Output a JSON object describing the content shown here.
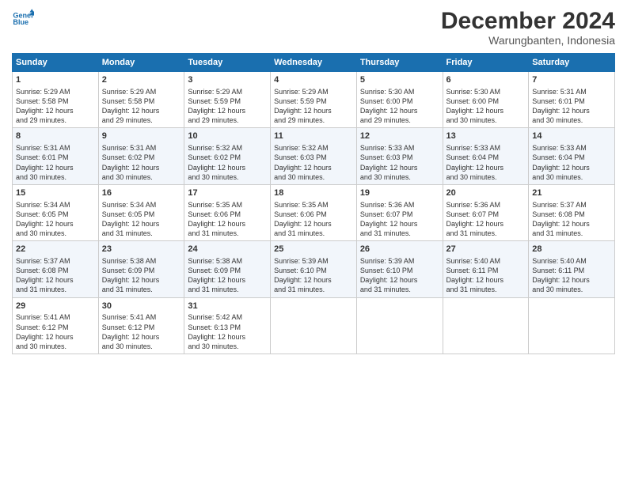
{
  "logo": {
    "line1": "General",
    "line2": "Blue"
  },
  "title": "December 2024",
  "subtitle": "Warungbanten, Indonesia",
  "days_header": [
    "Sunday",
    "Monday",
    "Tuesday",
    "Wednesday",
    "Thursday",
    "Friday",
    "Saturday"
  ],
  "weeks": [
    [
      {
        "day": "1",
        "lines": [
          "Sunrise: 5:29 AM",
          "Sunset: 5:58 PM",
          "Daylight: 12 hours",
          "and 29 minutes."
        ]
      },
      {
        "day": "2",
        "lines": [
          "Sunrise: 5:29 AM",
          "Sunset: 5:58 PM",
          "Daylight: 12 hours",
          "and 29 minutes."
        ]
      },
      {
        "day": "3",
        "lines": [
          "Sunrise: 5:29 AM",
          "Sunset: 5:59 PM",
          "Daylight: 12 hours",
          "and 29 minutes."
        ]
      },
      {
        "day": "4",
        "lines": [
          "Sunrise: 5:29 AM",
          "Sunset: 5:59 PM",
          "Daylight: 12 hours",
          "and 29 minutes."
        ]
      },
      {
        "day": "5",
        "lines": [
          "Sunrise: 5:30 AM",
          "Sunset: 6:00 PM",
          "Daylight: 12 hours",
          "and 29 minutes."
        ]
      },
      {
        "day": "6",
        "lines": [
          "Sunrise: 5:30 AM",
          "Sunset: 6:00 PM",
          "Daylight: 12 hours",
          "and 30 minutes."
        ]
      },
      {
        "day": "7",
        "lines": [
          "Sunrise: 5:31 AM",
          "Sunset: 6:01 PM",
          "Daylight: 12 hours",
          "and 30 minutes."
        ]
      }
    ],
    [
      {
        "day": "8",
        "lines": [
          "Sunrise: 5:31 AM",
          "Sunset: 6:01 PM",
          "Daylight: 12 hours",
          "and 30 minutes."
        ]
      },
      {
        "day": "9",
        "lines": [
          "Sunrise: 5:31 AM",
          "Sunset: 6:02 PM",
          "Daylight: 12 hours",
          "and 30 minutes."
        ]
      },
      {
        "day": "10",
        "lines": [
          "Sunrise: 5:32 AM",
          "Sunset: 6:02 PM",
          "Daylight: 12 hours",
          "and 30 minutes."
        ]
      },
      {
        "day": "11",
        "lines": [
          "Sunrise: 5:32 AM",
          "Sunset: 6:03 PM",
          "Daylight: 12 hours",
          "and 30 minutes."
        ]
      },
      {
        "day": "12",
        "lines": [
          "Sunrise: 5:33 AM",
          "Sunset: 6:03 PM",
          "Daylight: 12 hours",
          "and 30 minutes."
        ]
      },
      {
        "day": "13",
        "lines": [
          "Sunrise: 5:33 AM",
          "Sunset: 6:04 PM",
          "Daylight: 12 hours",
          "and 30 minutes."
        ]
      },
      {
        "day": "14",
        "lines": [
          "Sunrise: 5:33 AM",
          "Sunset: 6:04 PM",
          "Daylight: 12 hours",
          "and 30 minutes."
        ]
      }
    ],
    [
      {
        "day": "15",
        "lines": [
          "Sunrise: 5:34 AM",
          "Sunset: 6:05 PM",
          "Daylight: 12 hours",
          "and 30 minutes."
        ]
      },
      {
        "day": "16",
        "lines": [
          "Sunrise: 5:34 AM",
          "Sunset: 6:05 PM",
          "Daylight: 12 hours",
          "and 31 minutes."
        ]
      },
      {
        "day": "17",
        "lines": [
          "Sunrise: 5:35 AM",
          "Sunset: 6:06 PM",
          "Daylight: 12 hours",
          "and 31 minutes."
        ]
      },
      {
        "day": "18",
        "lines": [
          "Sunrise: 5:35 AM",
          "Sunset: 6:06 PM",
          "Daylight: 12 hours",
          "and 31 minutes."
        ]
      },
      {
        "day": "19",
        "lines": [
          "Sunrise: 5:36 AM",
          "Sunset: 6:07 PM",
          "Daylight: 12 hours",
          "and 31 minutes."
        ]
      },
      {
        "day": "20",
        "lines": [
          "Sunrise: 5:36 AM",
          "Sunset: 6:07 PM",
          "Daylight: 12 hours",
          "and 31 minutes."
        ]
      },
      {
        "day": "21",
        "lines": [
          "Sunrise: 5:37 AM",
          "Sunset: 6:08 PM",
          "Daylight: 12 hours",
          "and 31 minutes."
        ]
      }
    ],
    [
      {
        "day": "22",
        "lines": [
          "Sunrise: 5:37 AM",
          "Sunset: 6:08 PM",
          "Daylight: 12 hours",
          "and 31 minutes."
        ]
      },
      {
        "day": "23",
        "lines": [
          "Sunrise: 5:38 AM",
          "Sunset: 6:09 PM",
          "Daylight: 12 hours",
          "and 31 minutes."
        ]
      },
      {
        "day": "24",
        "lines": [
          "Sunrise: 5:38 AM",
          "Sunset: 6:09 PM",
          "Daylight: 12 hours",
          "and 31 minutes."
        ]
      },
      {
        "day": "25",
        "lines": [
          "Sunrise: 5:39 AM",
          "Sunset: 6:10 PM",
          "Daylight: 12 hours",
          "and 31 minutes."
        ]
      },
      {
        "day": "26",
        "lines": [
          "Sunrise: 5:39 AM",
          "Sunset: 6:10 PM",
          "Daylight: 12 hours",
          "and 31 minutes."
        ]
      },
      {
        "day": "27",
        "lines": [
          "Sunrise: 5:40 AM",
          "Sunset: 6:11 PM",
          "Daylight: 12 hours",
          "and 31 minutes."
        ]
      },
      {
        "day": "28",
        "lines": [
          "Sunrise: 5:40 AM",
          "Sunset: 6:11 PM",
          "Daylight: 12 hours",
          "and 30 minutes."
        ]
      }
    ],
    [
      {
        "day": "29",
        "lines": [
          "Sunrise: 5:41 AM",
          "Sunset: 6:12 PM",
          "Daylight: 12 hours",
          "and 30 minutes."
        ]
      },
      {
        "day": "30",
        "lines": [
          "Sunrise: 5:41 AM",
          "Sunset: 6:12 PM",
          "Daylight: 12 hours",
          "and 30 minutes."
        ]
      },
      {
        "day": "31",
        "lines": [
          "Sunrise: 5:42 AM",
          "Sunset: 6:13 PM",
          "Daylight: 12 hours",
          "and 30 minutes."
        ]
      },
      null,
      null,
      null,
      null
    ]
  ]
}
